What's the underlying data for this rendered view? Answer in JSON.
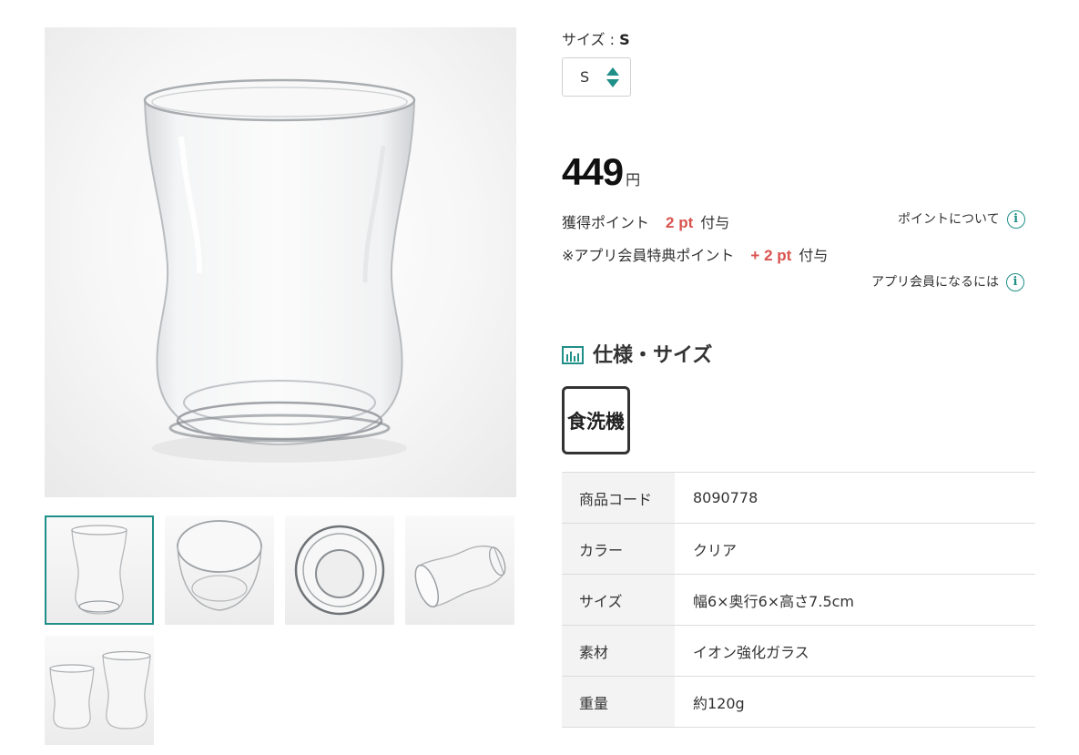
{
  "gallery": {
    "main_image_alt": "glass",
    "thumbnails": [
      {
        "name": "glass-front",
        "selected": true
      },
      {
        "name": "glass-angle",
        "selected": false
      },
      {
        "name": "glass-top",
        "selected": false
      },
      {
        "name": "glass-side",
        "selected": false
      },
      {
        "name": "glass-pair",
        "selected": false
      }
    ]
  },
  "size": {
    "label": "サイズ : ",
    "current": "S",
    "select_value": "S"
  },
  "price": {
    "amount": "449",
    "currency": "円"
  },
  "points": {
    "earned_label": "獲得ポイント",
    "earned_value": "2 pt",
    "earned_suffix": "付与",
    "app_label": "※アプリ会員特典ポイント",
    "app_value": "+ 2 pt",
    "app_suffix": "付与",
    "about_points_link": "ポイントについて",
    "become_member_link": "アプリ会員になるには"
  },
  "specs": {
    "title": "仕様・サイズ",
    "badge": "食洗機",
    "rows": [
      {
        "label": "商品コード",
        "value": "8090778"
      },
      {
        "label": "カラー",
        "value": "クリア"
      },
      {
        "label": "サイズ",
        "value": "幅6×奥行6×高さ7.5cm"
      },
      {
        "label": "素材",
        "value": "イオン強化ガラス"
      },
      {
        "label": "重量",
        "value": "約120g"
      }
    ]
  },
  "colors": {
    "accent": "#1f8f88",
    "points": "#d9534f"
  }
}
